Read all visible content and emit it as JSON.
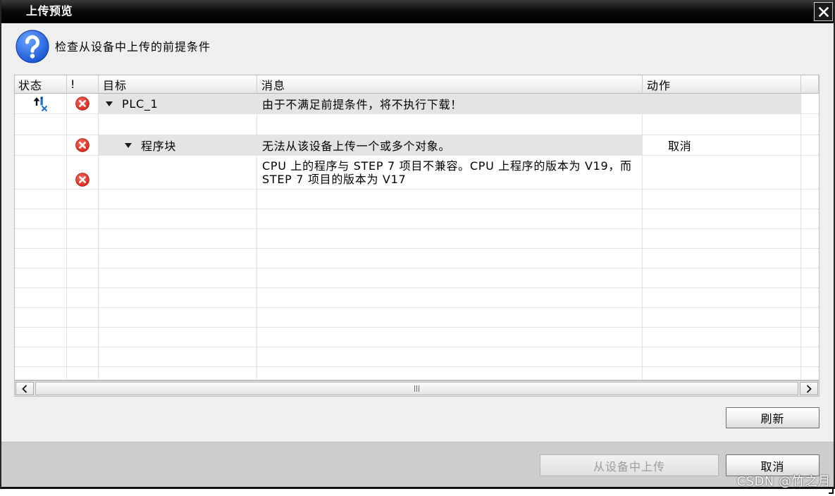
{
  "window": {
    "title": "上传预览",
    "close_icon": "close-icon"
  },
  "prompt": {
    "icon": "question-icon",
    "text": "检查从设备中上传的前提条件"
  },
  "table": {
    "columns": {
      "status": "状态",
      "severity": "!",
      "target": "目标",
      "message": "消息",
      "action": "动作"
    },
    "rows": [
      {
        "status_icon": "upload-error-icon",
        "severity_icon": "error-icon",
        "expand_icon": "caret-down-icon",
        "target": "PLC_1",
        "message": "由于不满足前提条件，将不执行下载！"
      },
      {},
      {
        "severity_icon": "error-icon",
        "expand_icon": "caret-down-icon",
        "target": "程序块",
        "message": "无法从该设备上传一个或多个对象。",
        "action": "取消"
      },
      {
        "severity_icon": "error-icon",
        "message_lines": [
          "CPU 上的程序与 STEP 7 项目不兼容。CPU 上程序的版本为 V19，而",
          "STEP 7 项目的版本为 V17"
        ]
      }
    ]
  },
  "scrollbar": {
    "left_icon": "chevron-left-icon",
    "right_icon": "chevron-right-icon",
    "thumb_icon": "grip-icon"
  },
  "buttons": {
    "refresh": "刷新",
    "upload_from_device": "从设备中上传",
    "upload_enabled": false,
    "cancel": "取消"
  },
  "watermark": "CSDN @竹之月",
  "colors": {
    "title-bar": "#0b0b0b",
    "dialog-bg": "#efefef",
    "footer-bg": "#cdcdcd",
    "row-highlight": "#e4e4e4",
    "grid-line": "#e2e2e2",
    "error-red": "#d7291d",
    "question-blue": "#1553d3",
    "status-blue": "#1b6fd2",
    "disabled-text": "#9b9b9b"
  }
}
